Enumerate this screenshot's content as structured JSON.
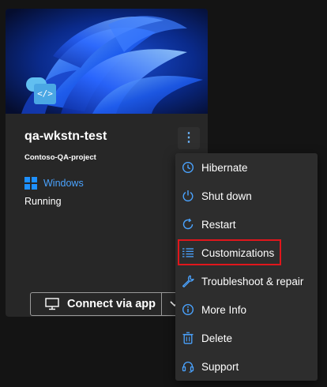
{
  "card": {
    "name": "qa-wkstn-test",
    "project": "Contoso-QA-project",
    "os": "Windows",
    "status": "Running",
    "more_options_glyph": "⋮",
    "badge_glyph": "</>",
    "connect_label": "Connect via app"
  },
  "menu": {
    "items": [
      {
        "label": "Hibernate",
        "icon": "clock-icon"
      },
      {
        "label": "Shut down",
        "icon": "power-icon"
      },
      {
        "label": "Restart",
        "icon": "restart-icon"
      },
      {
        "label": "Customizations",
        "icon": "list-icon"
      },
      {
        "label": "Troubleshoot & repair",
        "icon": "wrench-icon"
      },
      {
        "label": "More Info",
        "icon": "info-icon"
      },
      {
        "label": "Delete",
        "icon": "trash-icon"
      },
      {
        "label": "Support",
        "icon": "headset-icon"
      }
    ],
    "highlighted_item": "Customizations"
  },
  "colors": {
    "accent": "#4aa3ff",
    "highlight_border": "#e0161c",
    "card_bg": "#272727",
    "menu_bg": "#2d2d2d"
  }
}
